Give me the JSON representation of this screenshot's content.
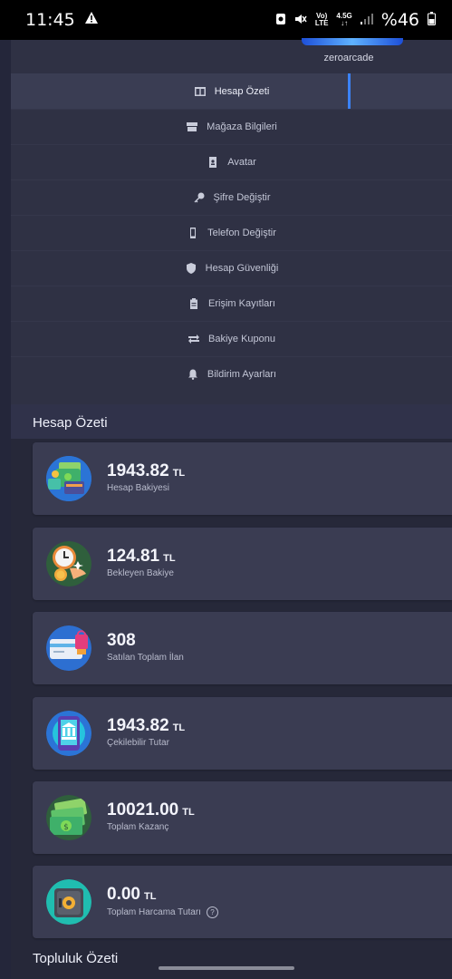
{
  "status_bar": {
    "time": "11:45",
    "warning_icon": "warning-icon",
    "battery_text": "%46",
    "network_labels": [
      "Vo)\nLTE",
      "4.5G"
    ]
  },
  "profile": {
    "username": "zeroarcade"
  },
  "menu": {
    "items": [
      {
        "label": "Hesap Özeti",
        "icon": "columns-icon",
        "active": true
      },
      {
        "label": "Mağaza Bilgileri",
        "icon": "store-icon"
      },
      {
        "label": "Avatar",
        "icon": "contact-card-icon"
      },
      {
        "label": "Şifre Değiştir",
        "icon": "key-icon"
      },
      {
        "label": "Telefon Değiştir",
        "icon": "phone-icon"
      },
      {
        "label": "Hesap Güvenliği",
        "icon": "shield-icon"
      },
      {
        "label": "Erişim Kayıtları",
        "icon": "clipboard-icon"
      },
      {
        "label": "Bakiye Kuponu",
        "icon": "exchange-icon"
      },
      {
        "label": "Bildirim Ayarları",
        "icon": "bell-icon"
      }
    ]
  },
  "summary": {
    "title": "Hesap Özeti",
    "cards": [
      {
        "value": "1943.82",
        "unit": "TL",
        "label": "Hesap Bakiyesi",
        "icon": "wallet-money-icon"
      },
      {
        "value": "124.81",
        "unit": "TL",
        "label": "Bekleyen Bakiye",
        "icon": "clock-coins-icon"
      },
      {
        "value": "308",
        "unit": "",
        "label": "Satılan Toplam İlan",
        "icon": "shopping-card-icon"
      },
      {
        "value": "1943.82",
        "unit": "TL",
        "label": "Çekilebilir Tutar",
        "icon": "bank-phone-icon"
      },
      {
        "value": "10021.00",
        "unit": "TL",
        "label": "Toplam Kazanç",
        "icon": "cash-stack-icon"
      },
      {
        "value": "0.00",
        "unit": "TL",
        "label": "Toplam Harcama Tutarı",
        "icon": "safe-icon",
        "help_icon": "question-circle-icon"
      }
    ]
  },
  "community": {
    "title": "Topluluk Özeti"
  }
}
